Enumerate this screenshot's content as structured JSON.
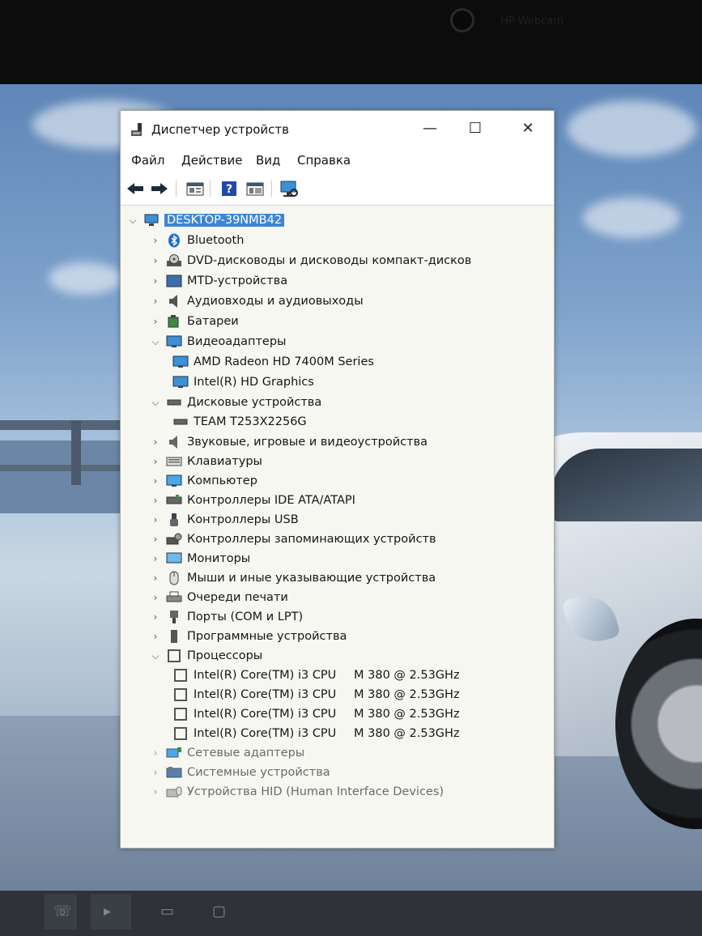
{
  "webcam_label": "HP Webcam",
  "window": {
    "title": "Диспетчер устройств",
    "controls": {
      "minimize": "—",
      "maximize": "☐",
      "close": "✕"
    }
  },
  "menu": [
    "Файл",
    "Действие",
    "Вид",
    "Справка"
  ],
  "toolbar": [
    "back-icon",
    "forward-icon",
    "properties-view-icon",
    "help-icon",
    "details-view-icon",
    "scan-hardware-icon"
  ],
  "tree": {
    "root": "DESKTOP-39NMB42",
    "categories": [
      {
        "label": "Bluetooth",
        "icon": "bluetooth-icon",
        "expanded": false
      },
      {
        "label": "DVD-дисководы и дисководы компакт-дисков",
        "icon": "dvd-drive-icon",
        "expanded": false
      },
      {
        "label": "MTD-устройства",
        "icon": "mtd-device-icon",
        "expanded": false
      },
      {
        "label": "Аудиовходы и аудиовыходы",
        "icon": "speaker-icon",
        "expanded": false
      },
      {
        "label": "Батареи",
        "icon": "battery-icon",
        "expanded": false
      },
      {
        "label": "Видеоадаптеры",
        "icon": "display-adapter-icon",
        "expanded": true,
        "children": [
          "AMD Radeon HD 7400M Series",
          "Intel(R) HD Graphics"
        ]
      },
      {
        "label": "Дисковые устройства",
        "icon": "disk-drive-icon",
        "expanded": true,
        "children": [
          "TEAM T253X2256G"
        ]
      },
      {
        "label": "Звуковые, игровые и видеоустройства",
        "icon": "sound-icon",
        "expanded": false
      },
      {
        "label": "Клавиатуры",
        "icon": "keyboard-icon",
        "expanded": false
      },
      {
        "label": "Компьютер",
        "icon": "computer-icon",
        "expanded": false
      },
      {
        "label": "Контроллеры IDE ATA/ATAPI",
        "icon": "ide-controller-icon",
        "expanded": false
      },
      {
        "label": "Контроллеры USB",
        "icon": "usb-icon",
        "expanded": false
      },
      {
        "label": "Контроллеры запоминающих устройств",
        "icon": "storage-controller-icon",
        "expanded": false
      },
      {
        "label": "Мониторы",
        "icon": "monitor-icon",
        "expanded": false
      },
      {
        "label": "Мыши и иные указывающие устройства",
        "icon": "mouse-icon",
        "expanded": false
      },
      {
        "label": "Очереди печати",
        "icon": "printer-icon",
        "expanded": false
      },
      {
        "label": "Порты (COM и LPT)",
        "icon": "port-icon",
        "expanded": false
      },
      {
        "label": "Программные устройства",
        "icon": "software-device-icon",
        "expanded": false
      },
      {
        "label": "Процессоры",
        "icon": "processor-icon",
        "expanded": true,
        "children": [
          {
            "name": "Intel(R) Core(TM) i3 CPU",
            "model": "M 380  @ 2.53GHz"
          },
          {
            "name": "Intel(R) Core(TM) i3 CPU",
            "model": "M 380  @ 2.53GHz"
          },
          {
            "name": "Intel(R) Core(TM) i3 CPU",
            "model": "M 380  @ 2.53GHz"
          },
          {
            "name": "Intel(R) Core(TM) i3 CPU",
            "model": "M 380  @ 2.53GHz"
          }
        ]
      },
      {
        "label": "Сетевые адаптеры",
        "icon": "network-adapter-icon",
        "expanded": false
      },
      {
        "label": "Системные устройства",
        "icon": "system-device-icon",
        "expanded": false
      },
      {
        "label": "Устройства HID (Human Interface Devices)",
        "icon": "hid-icon",
        "expanded": false
      }
    ]
  },
  "colors": {
    "selection": "#3d86d6",
    "window_bg": "#f7f7f2"
  }
}
